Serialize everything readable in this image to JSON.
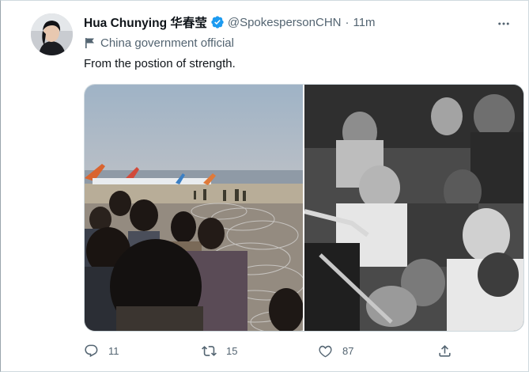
{
  "tweet": {
    "display_name": "Hua Chunying 华春莹",
    "handle": "@SpokespersonCHN",
    "separator": "·",
    "time": "11m",
    "account_label": "China government official",
    "text": "From the postion of strength."
  },
  "actions": {
    "reply_count": "11",
    "retweet_count": "15",
    "like_count": "87"
  },
  "icons": {
    "verified": "verified-badge-icon",
    "more": "more-options-icon",
    "label": "flag-icon",
    "reply": "reply-icon",
    "retweet": "retweet-icon",
    "like": "heart-icon",
    "share": "share-icon"
  },
  "colors": {
    "verified_blue": "#1d9bf0",
    "secondary_text": "#536471",
    "primary_text": "#0f1419"
  }
}
